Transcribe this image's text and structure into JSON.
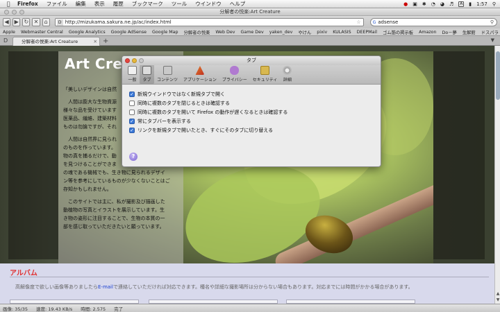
{
  "menubar": {
    "app": "Firefox",
    "items": [
      "ファイル",
      "編集",
      "表示",
      "履歴",
      "ブックマーク",
      "ツール",
      "ウインドウ",
      "ヘルプ"
    ],
    "clock": "1:57",
    "lang_badge": "A"
  },
  "window": {
    "title": "分解者の悦楽:Art Creature"
  },
  "toolbar": {
    "url": "http://mizukama.sakura.ne.jp/ac/index.html",
    "search_value": "adsense"
  },
  "bookmarks": [
    "Apple",
    "Webmaster Central",
    "Google Analytics",
    "Google AdSense",
    "Google Map",
    "分解者の悦楽",
    "Web Dev",
    "Game Dev",
    "yaken_dev",
    "やけん",
    "pixiv",
    "KULASIS",
    "DEEPMail",
    "ゴム筋の掲示板",
    "Amazon",
    "Do－夢",
    "生解館",
    "ドスパラ"
  ],
  "tab": {
    "label": "分解者の悦楽:Art Creature"
  },
  "page": {
    "site_title": "Art Crea",
    "paragraphs": [
      "「美しいデザインは自然",
      "　人間は膨大な生物資源\n様々な品を受けています\n医薬品、繊維、建築材料\nものは勿論ですが、それ",
      "　人間は自然界に見られ\nのものを作っています。\n物の真を捕るだけで、動\nを見つけることができま\nの魂である機械でも、生き物に見られるデザイ\nン等を参考にしているものが少なくないことはご\n存知かもしれません。",
      "　このサイトでは主に、私が撮影及び描画した\n動植物の写真とイラストを展示しています。生\nき物の姿形に注目することで、生物の本質の一\n部を感じ取っていただきたいと願っています。"
    ],
    "album_heading": "アルバム",
    "album_desc_before": "高解像度で欲しい画像等ありましたら",
    "album_link": "E-mail",
    "album_desc_after": "で連絡していただければ対応できます。種名や詳細な撮影場所は分からない場合もあります。対応までには時間がかかる場合があります。"
  },
  "dialog": {
    "title": "タブ",
    "panes": [
      {
        "label": "一般",
        "icon": "general-icon"
      },
      {
        "label": "タブ",
        "icon": "tabs-icon"
      },
      {
        "label": "コンテンツ",
        "icon": "content-icon"
      },
      {
        "label": "アプリケーション",
        "icon": "applications-icon"
      },
      {
        "label": "プライバシー",
        "icon": "privacy-icon"
      },
      {
        "label": "セキュリティ",
        "icon": "security-icon"
      },
      {
        "label": "詳細",
        "icon": "advanced-icon"
      }
    ],
    "selected_pane": "タブ",
    "options": [
      {
        "label": "新規ウインドウではなく新規タブで開く",
        "checked": true
      },
      {
        "label": "同時に複数のタブを閉じるときは確認する",
        "checked": false
      },
      {
        "label": "同時に複数のタブを開いて Firefox の動作が遅くなるときは確認する",
        "checked": false
      },
      {
        "label": "常にタブバーを表示する",
        "checked": true
      },
      {
        "label": "リンクを新規タブで開いたとき、すぐにそのタブに切り替える",
        "checked": true
      }
    ],
    "help_glyph": "?"
  },
  "statusbar": {
    "images": "画像: 35/35",
    "speed": "速度: 19.43 KB/s",
    "time": "時間: 2.575",
    "status": "完了"
  },
  "colors": {
    "accent_red": "#e03030",
    "link_blue": "#1a3fd0",
    "checkbox_blue": "#3a78d8"
  }
}
